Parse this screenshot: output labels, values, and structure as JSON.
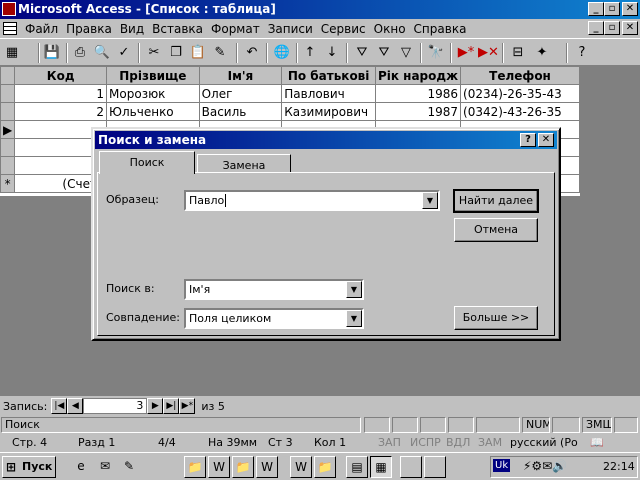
{
  "window": {
    "title": "Microsoft Access - [Список : таблица]"
  },
  "menu": [
    "Файл",
    "Правка",
    "Вид",
    "Вставка",
    "Формат",
    "Записи",
    "Сервис",
    "Окно",
    "Справка"
  ],
  "table": {
    "columns": [
      "Код",
      "Прізвище",
      "Ім'я",
      "По батькові",
      "Рік народж",
      "Телефон"
    ],
    "rows": [
      [
        "1",
        "Морозюк",
        "Олег",
        "Павлович",
        "1986",
        "(0234)-26-35-43"
      ],
      [
        "2",
        "Юльченко",
        "Василь",
        "Казимирович",
        "1987",
        "(0342)-43-26-35"
      ]
    ],
    "new_row": "(Счетч"
  },
  "dialog": {
    "title": "Поиск и замена",
    "tabs": [
      "Поиск",
      "Замена"
    ],
    "pattern_label": "Образец:",
    "pattern_value": "Павло",
    "find_next": "Найти далее",
    "cancel": "Отмена",
    "search_in_label": "Поиск в:",
    "search_in_value": "Ім'я",
    "match_label": "Совпадение:",
    "match_value": "Поля целиком",
    "more": "Больше >>"
  },
  "navigator": {
    "label": "Запись:",
    "current": "3",
    "of": "из  5"
  },
  "status": {
    "text": "Поиск",
    "num": "NUM",
    "ext": "ЗМЩ"
  },
  "status2": {
    "page": "Стр.  4",
    "section": "Разд  1",
    "pages": "4/4",
    "at": "На  39мм",
    "line": "Ст  3",
    "col": "Кол  1",
    "rec": "ЗАП",
    "trk": "ИСПР",
    "ext": "ВДЛ",
    "ovr": "ЗАМ",
    "lang": "русский (Ро"
  },
  "taskbar": {
    "start": "Пуск",
    "tray_lang": "Uk",
    "clock": "22:14"
  }
}
